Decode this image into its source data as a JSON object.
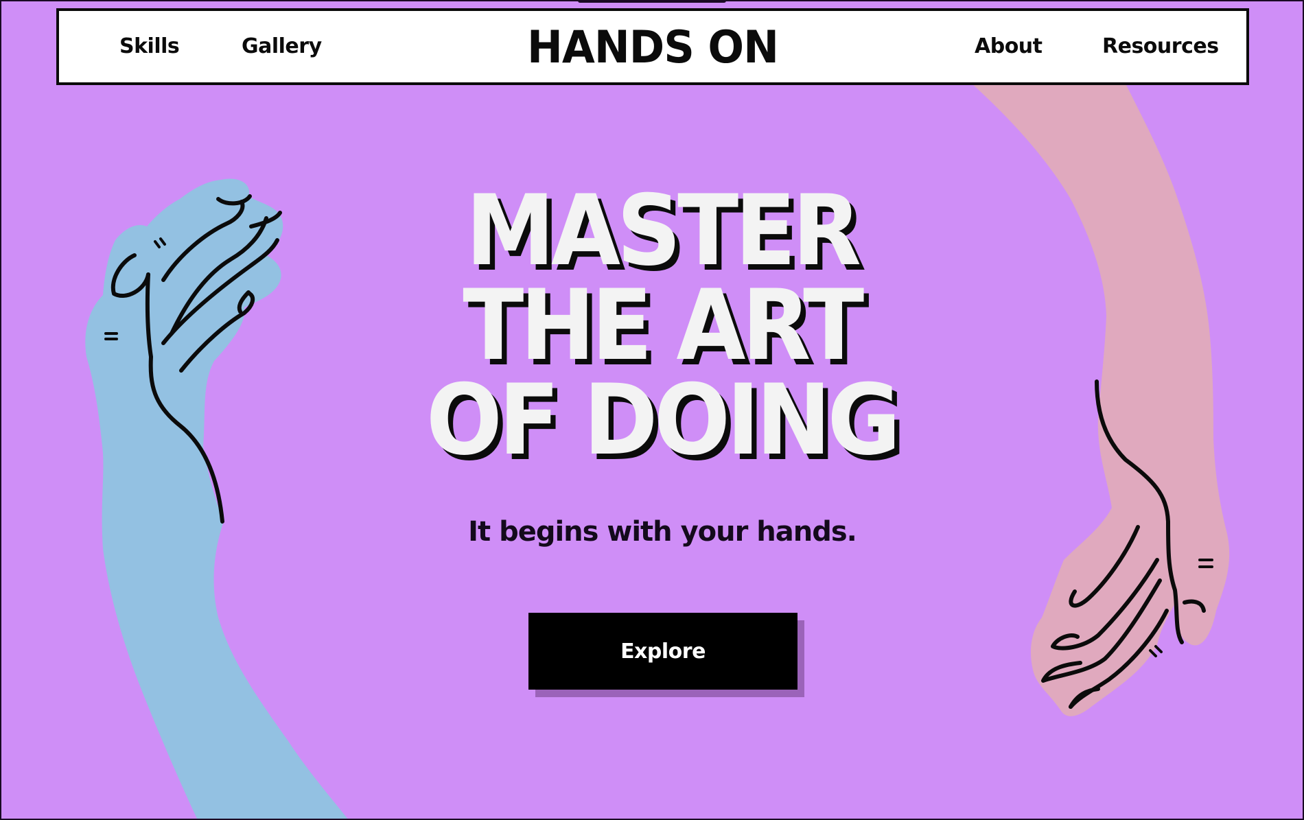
{
  "nav": {
    "left_links": [
      {
        "label": "Skills"
      },
      {
        "label": "Gallery"
      }
    ],
    "logo": "HANDS ON",
    "right_links": [
      {
        "label": "About"
      },
      {
        "label": "Resources"
      }
    ]
  },
  "hero": {
    "headline_lines": [
      "MASTER",
      "THE ART",
      "OF DOING"
    ],
    "tagline": "It begins with your hands.",
    "cta_label": "Explore"
  },
  "colors": {
    "background": "#cf8ef7",
    "left_hand": "#93c1e2",
    "right_hand": "#e0a9be",
    "headline": "#f3f3f3",
    "outline": "#0b0b0b"
  },
  "illustrations": {
    "left": "blue-hand-illustration",
    "right": "pink-hand-illustration"
  }
}
